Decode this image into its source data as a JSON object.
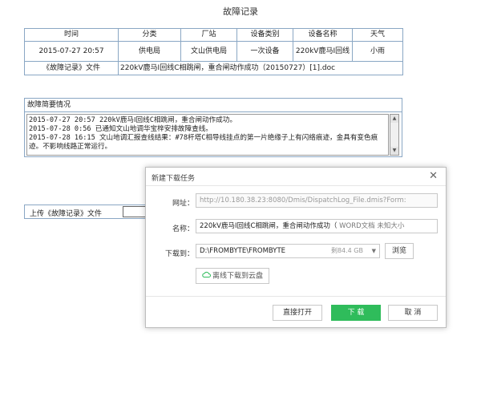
{
  "page": {
    "title": "故障记录"
  },
  "record_table": {
    "headers": [
      "时间",
      "分类",
      "厂站",
      "设备类别",
      "设备名称",
      "天气"
    ],
    "row": [
      "2015-07-27 20:57",
      "供电局",
      "文山供电局",
      "一次设备",
      "220kV鹿马Ⅰ回线",
      "小雨"
    ],
    "attachment_label": "《故障记录》文件",
    "attachment_link": "220kV鹿马Ⅰ回线C相跳闸，重合闸动作成功（20150727）[1].doc"
  },
  "summary": {
    "title": "故障简要情况",
    "text": "2015-07-27 20:57 220kV鹿马Ⅰ回线C相跳闸，重合闸动作成功。\n2015-07-28 0:56 已通知文山地调华宝梓安排故障查线。\n2015-07-28 16:15 文山地调汇报查线结果：#78杆塔C相导线挂点的第一片绝缘子上有闪络痕迹，金具有变色痕迹。不影响线路正常运行。"
  },
  "upload": {
    "label": "上传《故障记录》文件"
  },
  "dialog": {
    "title": "新建下载任务",
    "url_label": "网址：",
    "url_value": "http://10.180.38.23:8080/Dmis/DispatchLog_File.dmis?Form:",
    "name_label": "名称：",
    "name_value": "220kV鹿马Ⅰ回线C相跳闸，重合闸动作成功（",
    "name_meta": "WORD文档 未知大小",
    "save_label": "下载到：",
    "save_path": "D:\\FROMBYTE\\FROMBYTE",
    "free_space": "剩84.4 GB",
    "browse_button": "浏览",
    "cloud_button": "离线下载到云盘",
    "open_button": "直接打开",
    "download_button": "下 载",
    "cancel_button": "取 消"
  },
  "colors": {
    "border": "#8aa7c4",
    "link": "#1c33c9",
    "primary": "#2fbc5b"
  }
}
